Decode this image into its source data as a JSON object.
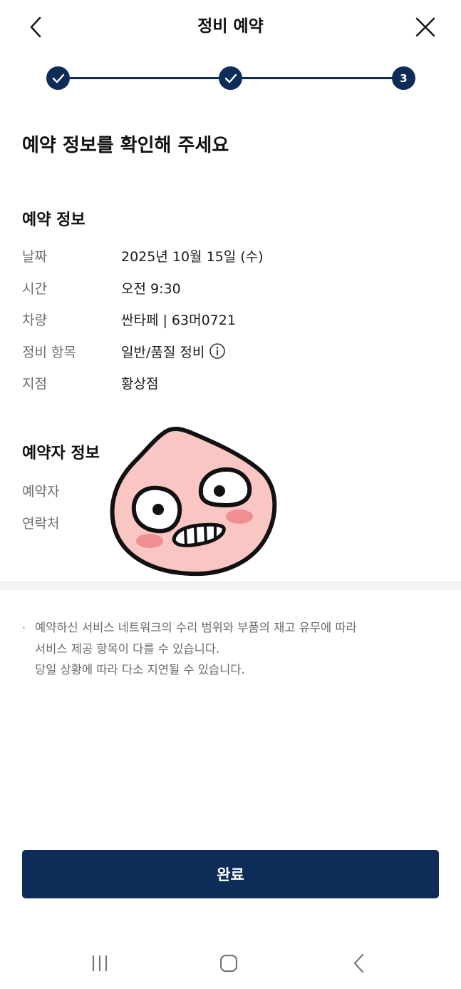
{
  "header": {
    "title": "정비 예약"
  },
  "stepper": {
    "steps": [
      {
        "state": "done",
        "label": ""
      },
      {
        "state": "done",
        "label": ""
      },
      {
        "state": "current",
        "label": "3"
      }
    ]
  },
  "headline": "예약 정보를 확인해 주세요",
  "reservation_info": {
    "title": "예약 정보",
    "rows": [
      {
        "label": "날짜",
        "value": "2025년 10월 15일 (수)"
      },
      {
        "label": "시간",
        "value": "오전 9:30"
      },
      {
        "label": "차량",
        "value": "싼타페 | 63머0721"
      },
      {
        "label": "정비 항목",
        "value": "일반/품질 정비"
      },
      {
        "label": "지점",
        "value": "황상점"
      }
    ]
  },
  "reserver_info": {
    "title": "예약자 정보",
    "rows": [
      {
        "label": "예약자",
        "value": ""
      },
      {
        "label": "연락처",
        "value": ""
      }
    ]
  },
  "notice": {
    "bullet": "·",
    "lines": [
      "예약하신 서비스 네트워크의 수리 범위와 부품의 재고 유무에 따라",
      "서비스 제공 항목이 다를 수 있습니다.",
      "당일 상황에 따라 다소 지연될 수 있습니다."
    ]
  },
  "complete_button": {
    "label": "완료"
  },
  "colors": {
    "primary": "#0d2c57",
    "label_gray": "#6f6f6f",
    "band": "#f2f3f5",
    "sticker_skin": "#f9c6c4",
    "sticker_blush": "#f08f91"
  },
  "icons": {
    "back": "chevron-left-icon",
    "close": "close-icon",
    "check": "check-icon",
    "info": "info-circle-icon",
    "nav_recents": "recents-icon",
    "nav_home": "home-icon",
    "nav_back": "nav-back-icon"
  }
}
